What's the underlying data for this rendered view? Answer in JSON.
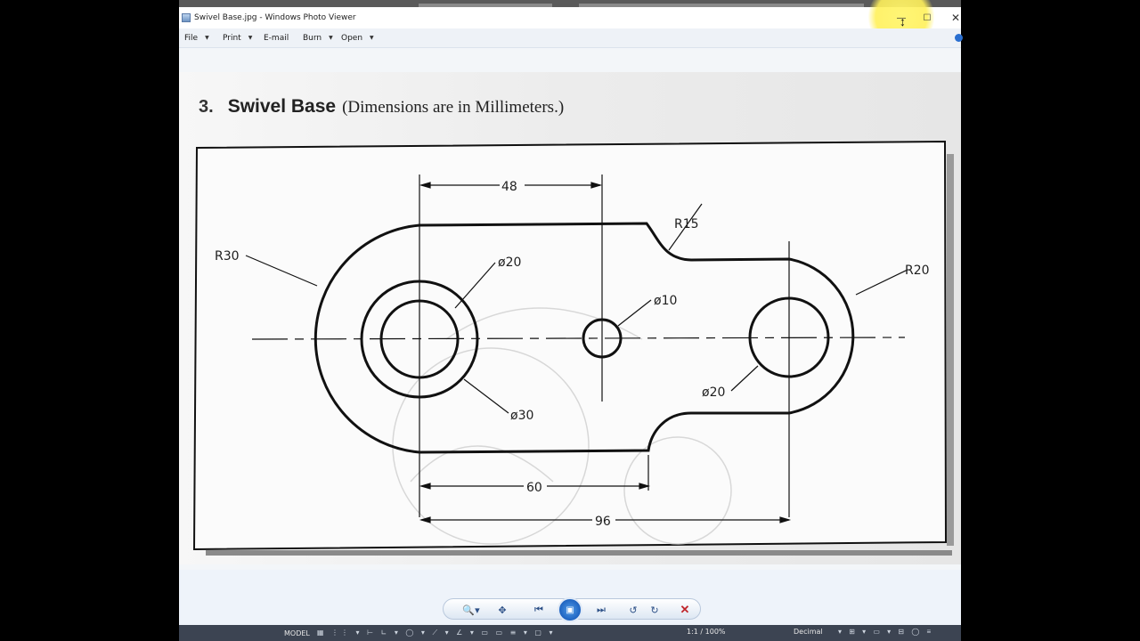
{
  "window": {
    "title": "Swivel Base.jpg - Windows Photo Viewer",
    "minimize_glyph": "—",
    "maximize_glyph": "☐",
    "close_glyph": "✕"
  },
  "menu": {
    "file": "File",
    "print": "Print",
    "email": "E-mail",
    "burn": "Burn",
    "open": "Open"
  },
  "document": {
    "number": "3.",
    "title": "Swivel Base",
    "subtitle": "(Dimensions are in Millimeters.)"
  },
  "dimensions": {
    "d48": "48",
    "r15": "R15",
    "r30": "R30",
    "phi20_left": "ø20",
    "phi10": "ø10",
    "r20": "R20",
    "phi20_right": "ø20",
    "phi30": "ø30",
    "d60": "60",
    "d96": "96"
  },
  "navbar": {
    "zoom_icon": "🔍▾",
    "fit_icon": "✥",
    "prev_icon": "⏮",
    "slideshow_icon": "▣",
    "next_icon": "⏭",
    "rotate_left_icon": "↺",
    "rotate_right_icon": "↻",
    "delete_icon": "✕"
  },
  "statusbar": {
    "model": "MODEL",
    "scale": "1:1 / 100%",
    "units": "Decimal"
  },
  "colors": {
    "accent": "#1e63c0",
    "delete": "#c0262b",
    "highlight": "#fff06a"
  }
}
